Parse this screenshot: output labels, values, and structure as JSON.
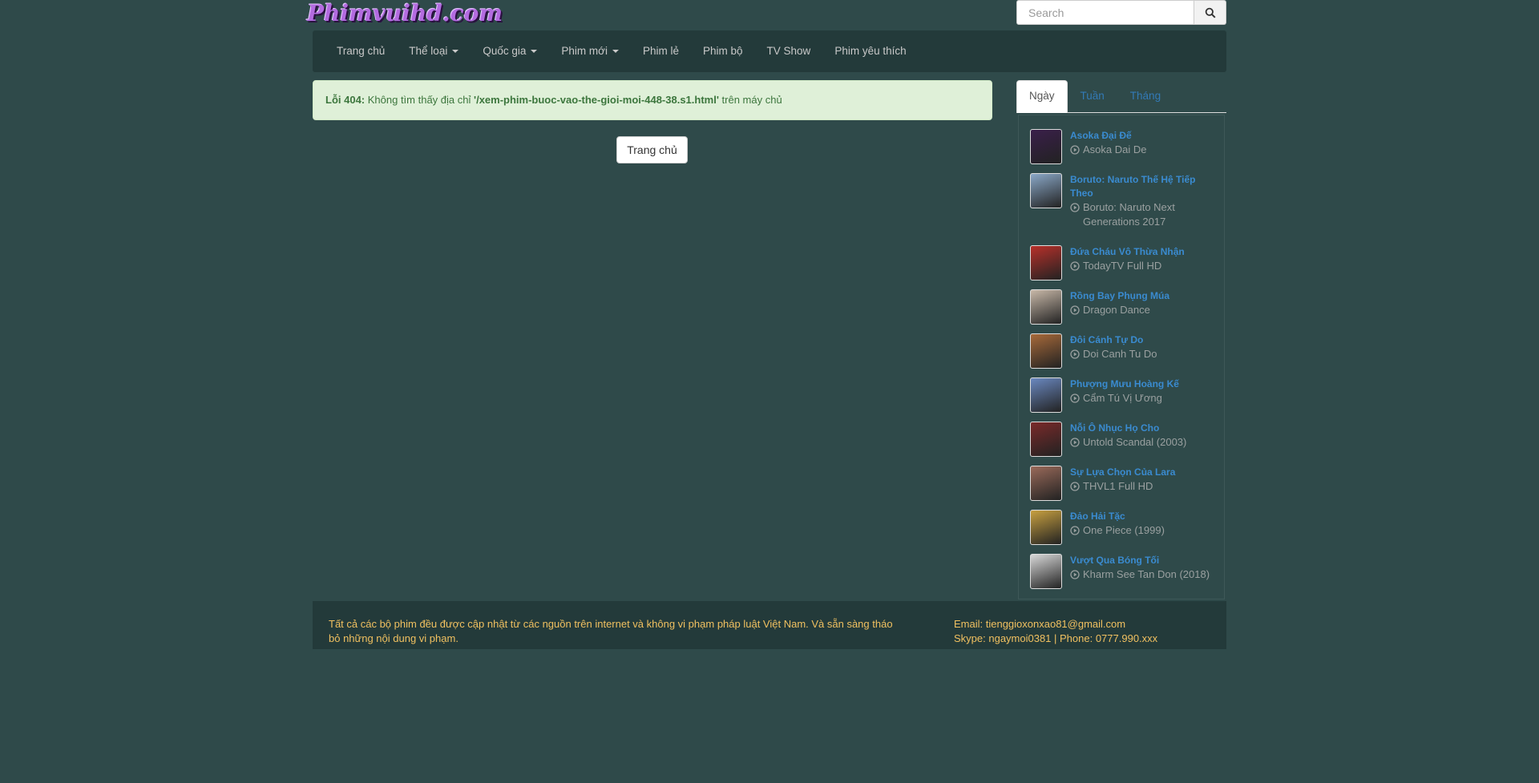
{
  "header": {
    "logo_text": "Phimvuihd.com",
    "search": {
      "placeholder": "Search"
    }
  },
  "nav": {
    "items": [
      {
        "label": "Trang chủ",
        "dropdown": false
      },
      {
        "label": "Thể loại",
        "dropdown": true
      },
      {
        "label": "Quốc gia",
        "dropdown": true
      },
      {
        "label": "Phim mới",
        "dropdown": true
      },
      {
        "label": "Phim lẻ",
        "dropdown": false
      },
      {
        "label": "Phim bộ",
        "dropdown": false
      },
      {
        "label": "TV Show",
        "dropdown": false
      },
      {
        "label": "Phim yêu thích",
        "dropdown": false
      }
    ]
  },
  "alert": {
    "prefix": "Lỗi 404:",
    "text_before": " Không tìm thấy địa chỉ ",
    "path": "'/xem-phim-buoc-vao-the-gioi-moi-448-38.s1.html'",
    "text_after": " trên máy chủ"
  },
  "home_button": {
    "label": "Trang chủ"
  },
  "sidebar": {
    "tabs": [
      {
        "label": "Ngày",
        "active": true
      },
      {
        "label": "Tuần",
        "active": false
      },
      {
        "label": "Tháng",
        "active": false
      }
    ],
    "movies": [
      {
        "title": "Asoka Đại Đế",
        "subtitle": "Asoka Dai De",
        "color": "#3a1f4a"
      },
      {
        "title": "Boruto: Naruto Thế Hệ Tiếp Theo",
        "subtitle": "Boruto: Naruto Next Generations 2017",
        "color": "#8aa8c8"
      },
      {
        "title": "Đứa Cháu Vô Thừa Nhận",
        "subtitle": "TodayTV Full HD",
        "color": "#b8302a"
      },
      {
        "title": "Rồng Bay Phụng Múa",
        "subtitle": "Dragon Dance",
        "color": "#c8b8a8"
      },
      {
        "title": "Đôi Cánh Tự Do",
        "subtitle": "Doi Canh Tu Do",
        "color": "#a86a3a"
      },
      {
        "title": "Phượng Mưu Hoàng Kế",
        "subtitle": "Cẩm Tú Vị Ương",
        "color": "#6a88c0"
      },
      {
        "title": "Nỗi Ô Nhục Họ Cho",
        "subtitle": "Untold Scandal (2003)",
        "color": "#7a2a2a"
      },
      {
        "title": "Sự Lựa Chọn Của Lara",
        "subtitle": "THVL1 Full HD",
        "color": "#9a6a5a"
      },
      {
        "title": "Đảo Hải Tặc",
        "subtitle": "One Piece (1999)",
        "color": "#c8a040"
      },
      {
        "title": "Vượt Qua Bóng Tối",
        "subtitle": "Kharm See Tan Don (2018)",
        "color": "#d8d8d8"
      }
    ]
  },
  "footer": {
    "disclaimer": "Tất cả các bộ phim đều được cập nhật từ các nguồn trên internet và không vi phạm pháp luật Việt Nam. Và sẵn sàng tháo bỏ những nội dung vi phạm.",
    "email": "Email: tienggioxonxao81@gmail.com",
    "contact": "Skype: ngaymoi0381 | Phone: 0777.990.xxx"
  }
}
